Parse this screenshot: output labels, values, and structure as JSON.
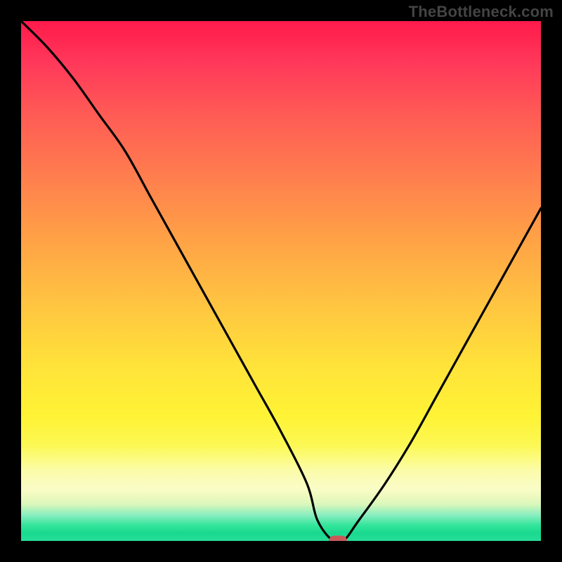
{
  "watermark": "TheBottleneck.com",
  "chart_data": {
    "type": "line",
    "title": "",
    "xlabel": "",
    "ylabel": "",
    "xlim": [
      0,
      100
    ],
    "ylim": [
      0,
      100
    ],
    "grid": false,
    "legend": false,
    "series": [
      {
        "name": "bottleneck-curve",
        "x": [
          0,
          5,
          10,
          15,
          20,
          25,
          30,
          35,
          40,
          45,
          50,
          55,
          57,
          60,
          62,
          65,
          70,
          75,
          80,
          85,
          90,
          95,
          100
        ],
        "y": [
          100,
          95,
          89,
          82,
          75,
          66,
          57,
          48,
          39,
          30,
          21,
          11,
          4,
          0,
          0,
          4,
          11,
          19,
          28,
          37,
          46,
          55,
          64
        ]
      }
    ],
    "marker": {
      "x": 61,
      "y": 0,
      "name": "optimal-point"
    },
    "background": {
      "type": "vertical-gradient",
      "stops": [
        {
          "pos": 0.0,
          "color": "#ff1a4b"
        },
        {
          "pos": 0.3,
          "color": "#ff7e4e"
        },
        {
          "pos": 0.66,
          "color": "#ffe23a"
        },
        {
          "pos": 0.9,
          "color": "#f4f9a2"
        },
        {
          "pos": 0.97,
          "color": "#33e59b"
        },
        {
          "pos": 1.0,
          "color": "#27dd99"
        }
      ]
    }
  },
  "colors": {
    "curve": "#000000",
    "marker": "#c95a5a",
    "frame": "#000000"
  }
}
